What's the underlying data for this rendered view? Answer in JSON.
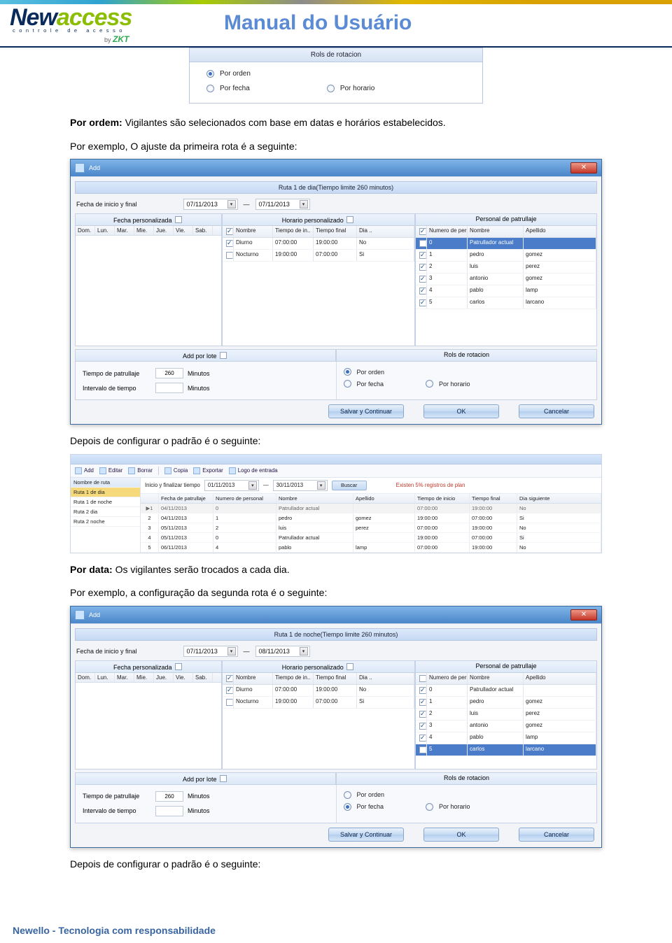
{
  "header": {
    "logo1": "New",
    "logo2": "access",
    "logo_sub": "controle de acesso",
    "logo_by": "by ",
    "logo_brand": "ZKT",
    "title": "Manual do Usuário"
  },
  "rols": {
    "title": "Rols de rotacion",
    "opt1": "Por orden",
    "opt2": "Por fecha",
    "opt3": "Por horario"
  },
  "text": {
    "p1a": "Por ordem:",
    "p1b": " Vigilantes são selecionados com base em datas e horários estabelecidos.",
    "p2": "Por exemplo, O ajuste da primeira rota é a seguinte:",
    "p3": "Depois de configurar o padrão é o seguinte:",
    "p4a": "Por data:",
    "p4b": " Os vigilantes serão trocados a cada dia.",
    "p5": "Por exemplo, a configuração da segunda rota é o seguinte:",
    "p6": "Depois de configurar o padrão é o seguinte:"
  },
  "dlg1": {
    "title": "Add",
    "banner": "Ruta 1 de dia(Tiempo limite 260 minutos)",
    "fechalbl": "Fecha de inicio y final",
    "d1": "07/11/2013",
    "d2": "07/11/2013",
    "band1": "Fecha personalizada",
    "band2": "Horario personalizado",
    "band3": "Personal de patrullaje",
    "days": [
      "Dom.",
      "Lun.",
      "Mar.",
      "Mie.",
      "Jue.",
      "Vie.",
      "Sab."
    ],
    "hhead": [
      "Nombre",
      "Tiempo de in..",
      "Tiempo final",
      "Dia .."
    ],
    "hrows": [
      [
        "Diurno",
        "07:00:00",
        "19:00:00",
        "No"
      ],
      [
        "Nocturno",
        "19:00:00",
        "07:00:00",
        "Si"
      ]
    ],
    "phead": [
      "Numero de personal",
      "Nombre",
      "Apellido"
    ],
    "prows": [
      {
        "n": "0",
        "nom": "Patrullador actual",
        "ap": "",
        "sel": true
      },
      {
        "n": "1",
        "nom": "pedro",
        "ap": "gomez"
      },
      {
        "n": "2",
        "nom": "luis",
        "ap": "perez"
      },
      {
        "n": "3",
        "nom": "antonio",
        "ap": "gomez"
      },
      {
        "n": "4",
        "nom": "pablo",
        "ap": "lamp"
      },
      {
        "n": "5",
        "nom": "carlos",
        "ap": "larcano"
      }
    ],
    "addlote": "Add por lote",
    "rolrot": "Rols de rotacion",
    "tp": "Tiempo de patrullaje",
    "tp_val": "260",
    "min": "Minutos",
    "it": "Intervalo de tiempo",
    "ro1": "Por orden",
    "ro2": "Por fecha",
    "ro3": "Por horario",
    "b1": "Salvar y Continuar",
    "b2": "OK",
    "b3": "Cancelar"
  },
  "listing": {
    "tb": {
      "add": "Add",
      "editar": "Editar",
      "borrar": "Borrar",
      "copia": "Copia",
      "exportar": "Exportar",
      "logo": "Logo de entrada"
    },
    "side_h": "Nombre de ruta",
    "side": [
      "Ruta 1 de dia",
      "Ruta 1 de noche",
      "Ruta 2 dia",
      "Ruta 2 noche"
    ],
    "search_lbl": "Inicio y finalizar tiempo",
    "s1": "01/11/2013",
    "s2": "30/11/2013",
    "buscar": "Buscar",
    "warn": "Existen 5% registros de plan",
    "ghead": [
      "",
      "Fecha de patrullaje",
      "Numero de personal",
      "Nombre",
      "Apellido",
      "Tiempo de inicio",
      "Tiempo final",
      "Dia siguiente"
    ],
    "rows": [
      {
        "i": "▶1",
        "fp": "04/11/2013",
        "np": "0",
        "nom": "Patrullador actual",
        "ap": "",
        "ti": "07:00:00",
        "tf": "19:00:00",
        "d": "No",
        "alt": true
      },
      {
        "i": "2",
        "fp": "04/11/2013",
        "np": "1",
        "nom": "pedro",
        "ap": "gomez",
        "ti": "19:00:00",
        "tf": "07:00:00",
        "d": "Si"
      },
      {
        "i": "3",
        "fp": "05/11/2013",
        "np": "2",
        "nom": "luis",
        "ap": "perez",
        "ti": "07:00:00",
        "tf": "19:00:00",
        "d": "No"
      },
      {
        "i": "4",
        "fp": "05/11/2013",
        "np": "0",
        "nom": "Patrullador actual",
        "ap": "",
        "ti": "19:00:00",
        "tf": "07:00:00",
        "d": "Si"
      },
      {
        "i": "5",
        "fp": "06/11/2013",
        "np": "4",
        "nom": "pablo",
        "ap": "lamp",
        "ti": "07:00:00",
        "tf": "19:00:00",
        "d": "No"
      }
    ]
  },
  "dlg2": {
    "title": "Add",
    "banner": "Ruta 1 de noche(Tiempo limite 260 minutos)",
    "fechalbl": "Fecha de inicio y final",
    "d1": "07/11/2013",
    "d2": "08/11/2013",
    "band1": "Fecha personalizada",
    "band2": "Horario personalizado",
    "band3": "Personal de patrullaje",
    "hrows": [
      [
        "Diurno",
        "07:00:00",
        "19:00:00",
        "No"
      ],
      [
        "Nocturno",
        "19:00:00",
        "07:00:00",
        "Si"
      ]
    ],
    "prows": [
      {
        "n": "0",
        "nom": "Patrullador actual",
        "ap": ""
      },
      {
        "n": "1",
        "nom": "pedro",
        "ap": "gomez"
      },
      {
        "n": "2",
        "nom": "luis",
        "ap": "perez"
      },
      {
        "n": "3",
        "nom": "antonio",
        "ap": "gomez"
      },
      {
        "n": "4",
        "nom": "pablo",
        "ap": "lamp"
      },
      {
        "n": "5",
        "nom": "carlos",
        "ap": "larcano",
        "sel": true
      }
    ],
    "addlote": "Add por lote",
    "rolrot": "Rols de rotacion",
    "tp": "Tiempo de patrullaje",
    "tp_val": "260",
    "min": "Minutos",
    "it": "Intervalo de tiempo",
    "ro1": "Por orden",
    "ro2": "Por fecha",
    "ro3": "Por horario",
    "b1": "Salvar y Continuar",
    "b2": "OK",
    "b3": "Cancelar"
  },
  "footer": "Newello - Tecnologia com responsabilidade"
}
